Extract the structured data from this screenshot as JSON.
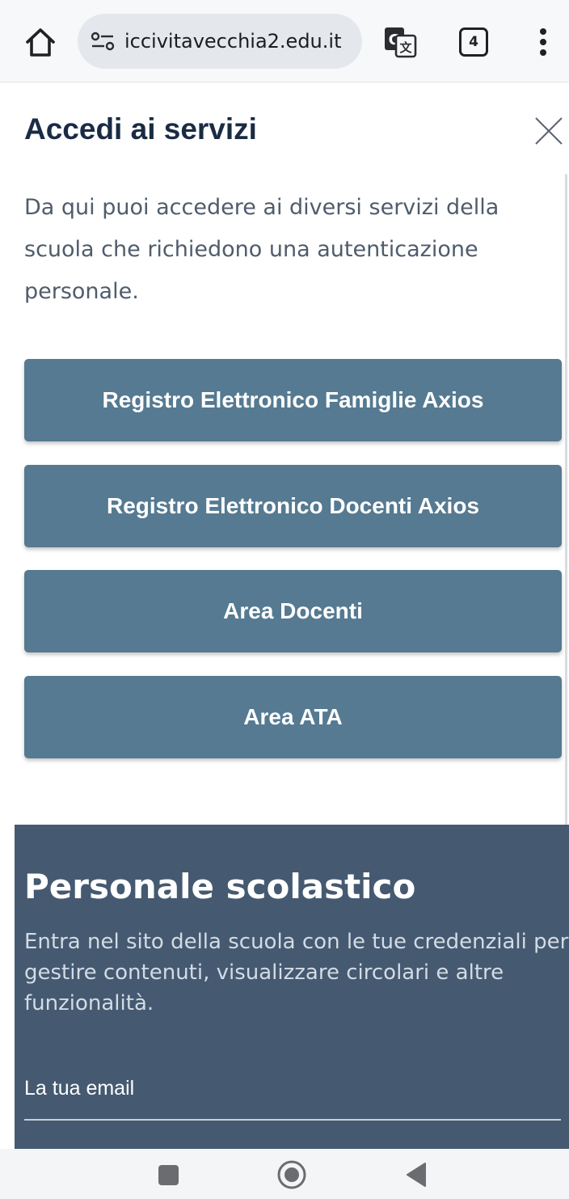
{
  "browser": {
    "url": "iccivitavecchia2.edu.it",
    "tab_count": "4",
    "icons": [
      "home-icon",
      "site-info-icon",
      "translate-icon",
      "more-vert-icon"
    ]
  },
  "modal": {
    "title": "Accedi ai servizi",
    "intro": "Da qui puoi accedere ai diversi servizi della scuola che richiedono una autenticazione personale.",
    "close_icon": "close-icon",
    "buttons": [
      "Registro Elettronico Famiglie Axios",
      "Registro Elettronico Docenti Axios",
      "Area Docenti",
      "Area ATA"
    ],
    "button_color": "#557a91"
  },
  "staff_login": {
    "title": "Personale scolastico",
    "description": "Entra nel sito della scuola con le tue credenziali per gestire contenuti, visualizzare circolari e altre funzionalità.",
    "email_label": "La tua email",
    "email_value": "",
    "background_color": "#455a71"
  },
  "system_nav": {
    "icons": [
      "recents-icon",
      "home-circle-icon",
      "back-icon"
    ]
  }
}
